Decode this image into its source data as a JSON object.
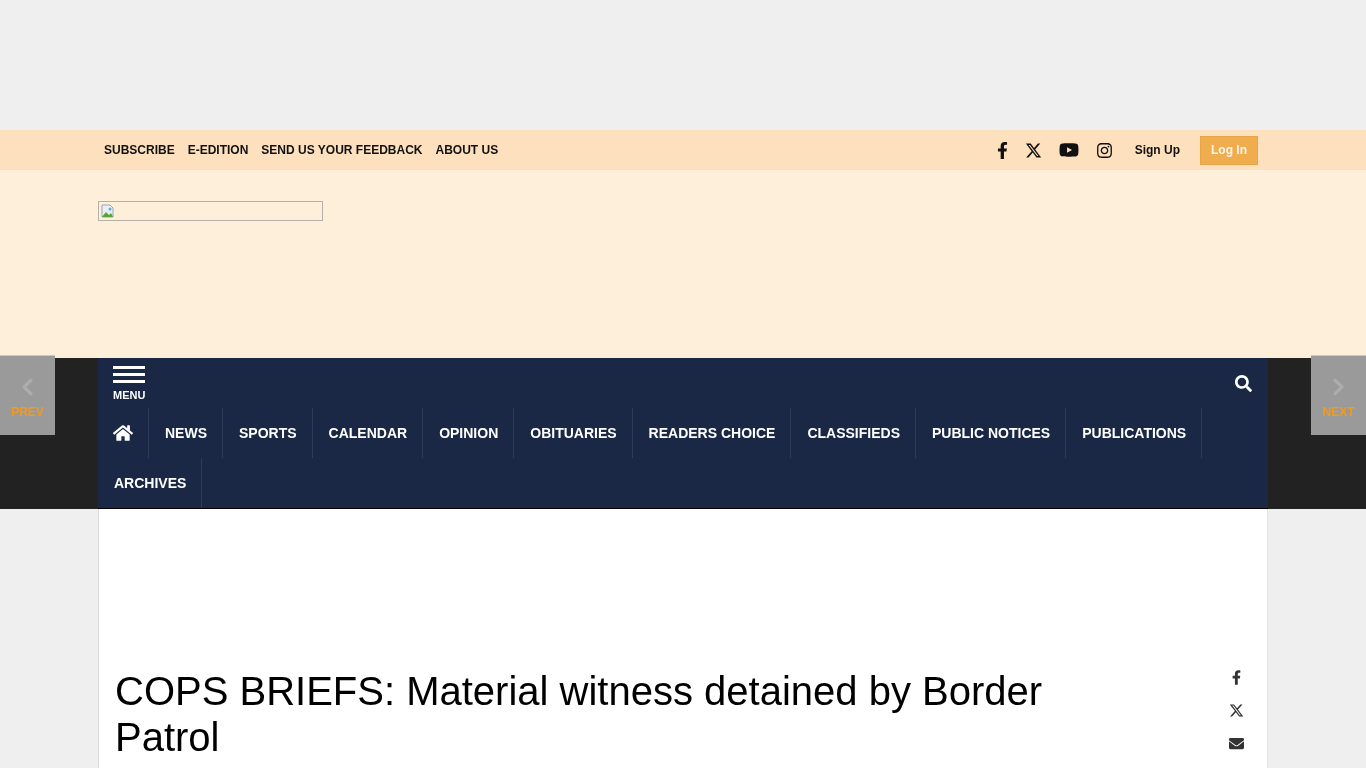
{
  "top_bar": {
    "links": [
      "SUBSCRIBE",
      "E-EDITION",
      "SEND US YOUR FEEDBACK",
      "ABOUT US"
    ],
    "sign_up": "Sign Up",
    "log_in": "Log In"
  },
  "pager": {
    "prev": "PREV",
    "next": "NEXT"
  },
  "nav": {
    "menu_label": "MENU",
    "items": [
      "NEWS",
      "SPORTS",
      "CALENDAR",
      "OPINION",
      "OBITUARIES",
      "READERS CHOICE",
      "CLASSIFIEDS",
      "PUBLIC NOTICES",
      "PUBLICATIONS",
      "ARCHIVES"
    ]
  },
  "article": {
    "title": "COPS BRIEFS: Material witness detained by Border Patrol"
  }
}
